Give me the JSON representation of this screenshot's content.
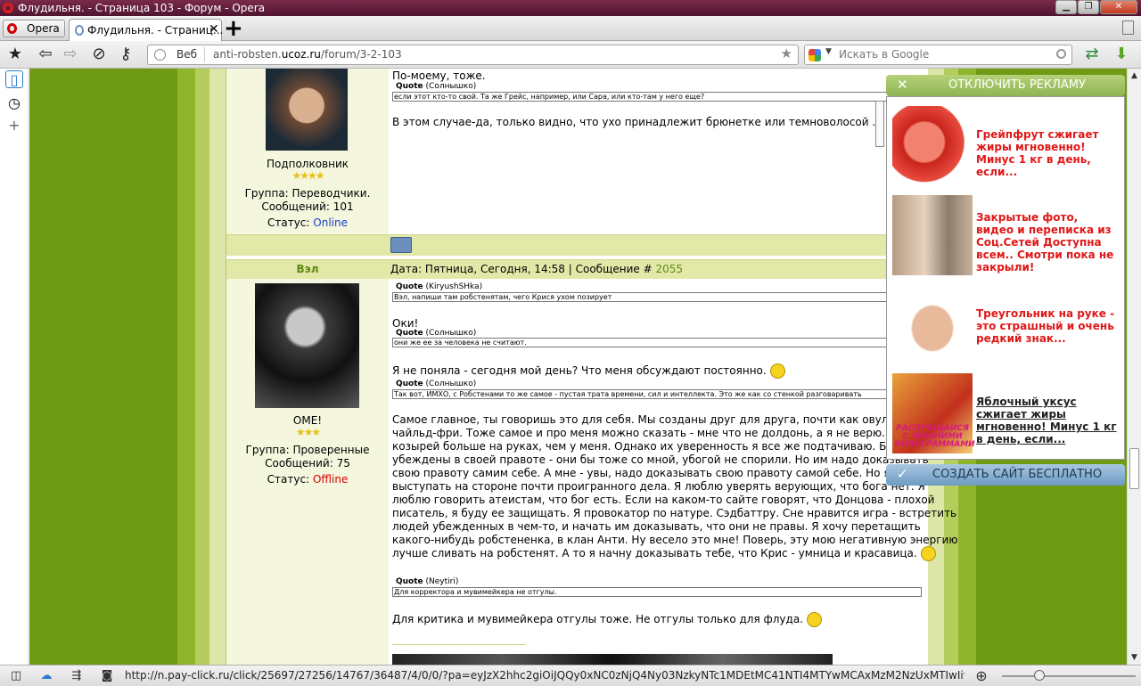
{
  "window": {
    "title": "Флудильня. - Страница 103 - Форум - Opera"
  },
  "tabbar": {
    "opera_label": "Opera",
    "tab_title": "Флудильня. - Страниц..."
  },
  "navbar": {
    "address_prefix": "Веб",
    "url_left": "anti-robsten.",
    "url_domain": "ucoz.ru",
    "url_path": "/forum/3-2-103",
    "search_placeholder": "Искать в Google"
  },
  "posts": [
    {
      "rank": "Подполковник",
      "stars": "★★★★",
      "group": "Группа: Переводчики.",
      "messages": "Сообщений: 101",
      "status_label": "Статус:",
      "status": "Online",
      "lines": {
        "l1": "По-моему, тоже.",
        "q1_head": "Quote",
        "q1_author": "(Солнышко)",
        "q1_text": "если этот кто-то свой. Та же Грейс, например, или Сара, или кто-там у него еще?",
        "l2": "В этом случае-да, только видно, что ухо принадлежит брюнетке или темноволосой .)"
      }
    },
    {
      "author": "Вэл",
      "date_label": "Дата: Пятница, Сегодня, 14:58 | Сообщение #",
      "post_number": "2055",
      "rank": "OME!",
      "stars": "★★★",
      "group": "Группа: Проверенные",
      "messages": "Сообщений: 75",
      "status_label": "Статус:",
      "status": "Offline",
      "lines": {
        "q1_head": "Quote",
        "q1_author": "(KiryushSHka)",
        "q1_text": "Вэл, напиши там робстенятам, чего Крися ухом позирует",
        "l1": "Оки!",
        "q2_head": "Quote",
        "q2_author": "(Солнышко)",
        "q2_text": "они же ее за человека не считают.",
        "l2": "Я не поняла - сегодня мой день? Что меня обсуждают постоянно.",
        "q3_head": "Quote",
        "q3_author": "(Солнышко)",
        "q3_text": "Так вот, ИМХО, с Робстенами то же самое - пустая трата времени, сил и интеллекта. Это же как со стенкой разговаривать",
        "p1": "Самое главное, ты говоришь это для себя. Мы созданы друг для друга, почти как овуляшки и",
        "p2": "чайльд-фри. Тоже самое и про меня можно сказать - мне что не долдонь, а я не верю. И у них",
        "p3": "козырей больше на руках, чем у меня. Однако их уверенность я все же подтачиваю. Будь они",
        "p4": "убеждены в своей правоте - они бы тоже со мной, убогой не спорили. Но им надо доказывать",
        "p5": "свою правоту самим себе. А мне - увы, надо доказывать свою правоту самой себе. Но я люблю",
        "p6": "выступать на стороне почти проигранного дела. Я люблю уверять верующих, что бога нет. Я",
        "p7": "люблю говорить атеистам, что бог есть. Если на каком-то сайте говорят, что Донцова - плохой",
        "p8": "писатель, я буду ее защищать. Я провокатор по натуре. Сэдбаттру. Сне нравится игра - встретить",
        "p9": "людей убежденных в чем-то, и начать им доказывать, что они не правы. Я хочу перетащить",
        "p10": "какого-нибудь робстененка, в клан Анти. Ну весело это мне! Поверь, эту мою негативную энергию",
        "p11": "лучше сливать на робстенят. А то я начну доказывать тебе, что Крис - умница и красавица.",
        "q4_head": "Quote",
        "q4_author": "(Neytiri)",
        "q4_text": "Для корректора и мувимейкера не отгулы.",
        "l3": "Для критика и мувимейкера отгулы тоже. Не отгулы только для флуда."
      }
    }
  ],
  "ad": {
    "close_label": "ОТКЛЮЧИТЬ РЕКЛАМУ",
    "items": [
      {
        "text": "Грейпфрут сжигает жиры мгновенно! Минус 1 кг в день, если..."
      },
      {
        "text": "Закрытые фото, видео и переписка из Соц.Сетей Доступна всем.. Смотри пока не закрыли!"
      },
      {
        "text": "Треугольник на руке - это страшный и очень редкий знак..."
      },
      {
        "text": "Яблочный уксус сжигает жиры мгновенно! Минус 1 кг в день, если...",
        "image_caption": "РАСПРОЩАЙСЯ С ЛИШНИМИ КИЛОГРАММАМИ"
      }
    ],
    "create_label": "СОЗДАТЬ САЙТ БЕСПЛАТНО"
  },
  "statusbar": {
    "link": "http://n.pay-click.ru/click/25697/27256/14767/36487/4/0/0/?pa=eyJzX2hhc2giOiJQQy0xNC0zNjQ4Ny03NzkyNTc1MDEtMC41NTI4MTYwMCAxMzM2NzUxMTIwIiwKICAgICAgICAg..."
  },
  "colors": {
    "forum_green": "#6e9a14",
    "post_bar": "#e2e9a8",
    "online": "#1a3dc8",
    "offline": "#d40000",
    "ad_red": "#e01818"
  }
}
